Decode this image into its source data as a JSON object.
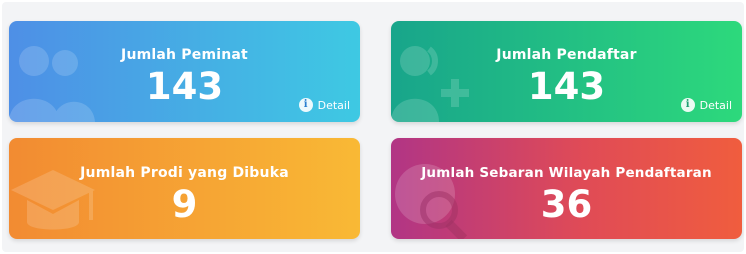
{
  "cards": [
    {
      "title": "Jumlah Peminat",
      "value": "143",
      "link_label": "Detail",
      "icon": "users-icon"
    },
    {
      "title": "Jumlah Pendaftar",
      "value": "143",
      "link_label": "Detail",
      "icon": "user-plus-icon"
    },
    {
      "title": "Jumlah Prodi yang Dibuka",
      "value": "9",
      "icon": "graduation-cap-icon"
    },
    {
      "title": "Jumlah Sebaran Wilayah Pendaftaran",
      "value": "36",
      "icon": "globe-search-icon"
    }
  ],
  "colors": {
    "peminat": [
      "#4e8fe6",
      "#3ec9e3"
    ],
    "pendaftar": [
      "#18a58b",
      "#2dd97c"
    ],
    "prodi": [
      "#f28b32",
      "#f9b935"
    ],
    "wilayah": [
      "#b13585",
      "#f05d3e"
    ]
  }
}
